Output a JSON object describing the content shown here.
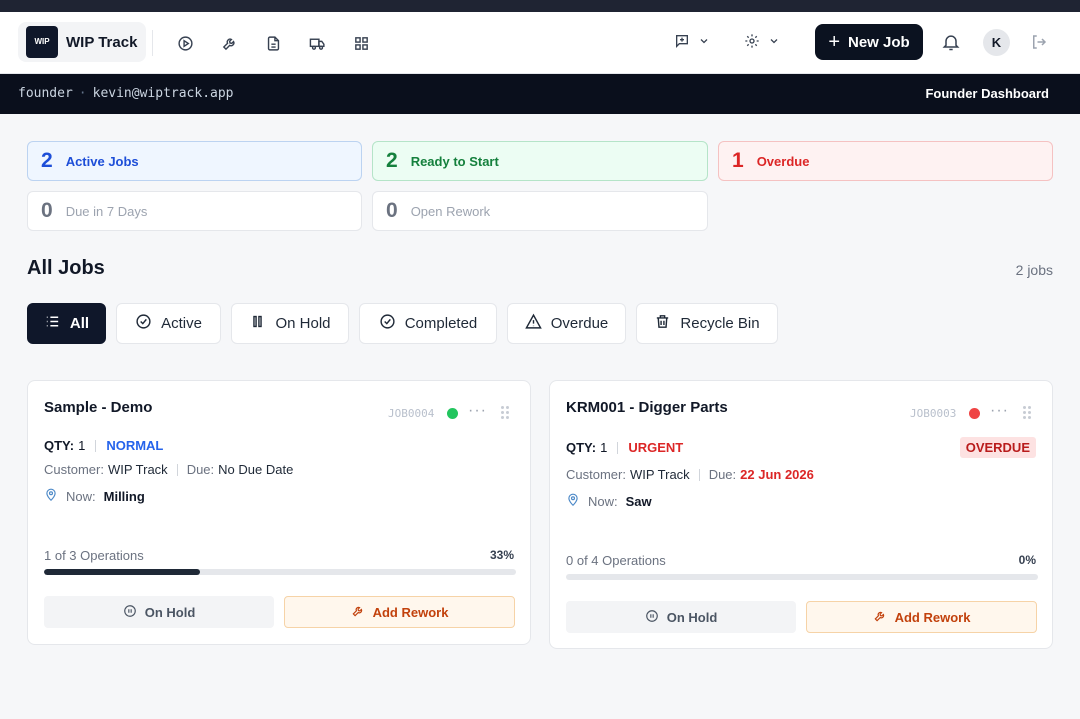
{
  "app": {
    "name": "WIP Track",
    "logo_text": "WIP"
  },
  "nav": {
    "icons": [
      "play-icon",
      "wrench-icon",
      "document-icon",
      "truck-icon",
      "grid-icon"
    ],
    "new_job_label": "New Job",
    "avatar_initial": "K"
  },
  "userbar": {
    "role": "founder",
    "separator": "·",
    "email": "kevin@wiptrack.app",
    "dashboard": "Founder Dashboard"
  },
  "stats": [
    {
      "value": "2",
      "label": "Active Jobs"
    },
    {
      "value": "2",
      "label": "Ready to Start"
    },
    {
      "value": "1",
      "label": "Overdue"
    },
    {
      "value": "0",
      "label": "Due in 7 Days"
    },
    {
      "value": "0",
      "label": "Open Rework"
    }
  ],
  "jobs_section": {
    "title": "All Jobs",
    "count": "2 jobs"
  },
  "filters": [
    {
      "label": "All",
      "icon": "list-icon",
      "active": true
    },
    {
      "label": "Active",
      "icon": "check-circle-icon"
    },
    {
      "label": "On Hold",
      "icon": "pause-icon"
    },
    {
      "label": "Completed",
      "icon": "check-circle-icon"
    },
    {
      "label": "Overdue",
      "icon": "warning-icon"
    },
    {
      "label": "Recycle Bin",
      "icon": "trash-icon"
    }
  ],
  "cards": [
    {
      "title": "Sample - Demo",
      "job_id": "JOB0004",
      "status_color": "#22c55e",
      "qty_label": "QTY:",
      "qty": "1",
      "priority": "NORMAL",
      "priority_color": "#2563eb",
      "customer_label": "Customer:",
      "customer": "WIP Track",
      "due_label": "Due:",
      "due": "No Due Date",
      "now_label": "Now:",
      "now": "Milling",
      "ops": "1 of 3 Operations",
      "pct": "33%",
      "progress": 0.33,
      "hold_label": "On Hold",
      "rework_label": "Add Rework"
    },
    {
      "title": "KRM001 - Digger Parts",
      "job_id": "JOB0003",
      "status_color": "#ef4444",
      "qty_label": "QTY:",
      "qty": "1",
      "priority": "URGENT",
      "priority_color": "#dc2626",
      "badge": "OVERDUE",
      "customer_label": "Customer:",
      "customer": "WIP Track",
      "due_label": "Due:",
      "due": "22 Jun 2026",
      "now_label": "Now:",
      "now": "Saw",
      "ops": "0 of 4 Operations",
      "pct": "0%",
      "progress": 0,
      "hold_label": "On Hold",
      "rework_label": "Add Rework"
    }
  ]
}
